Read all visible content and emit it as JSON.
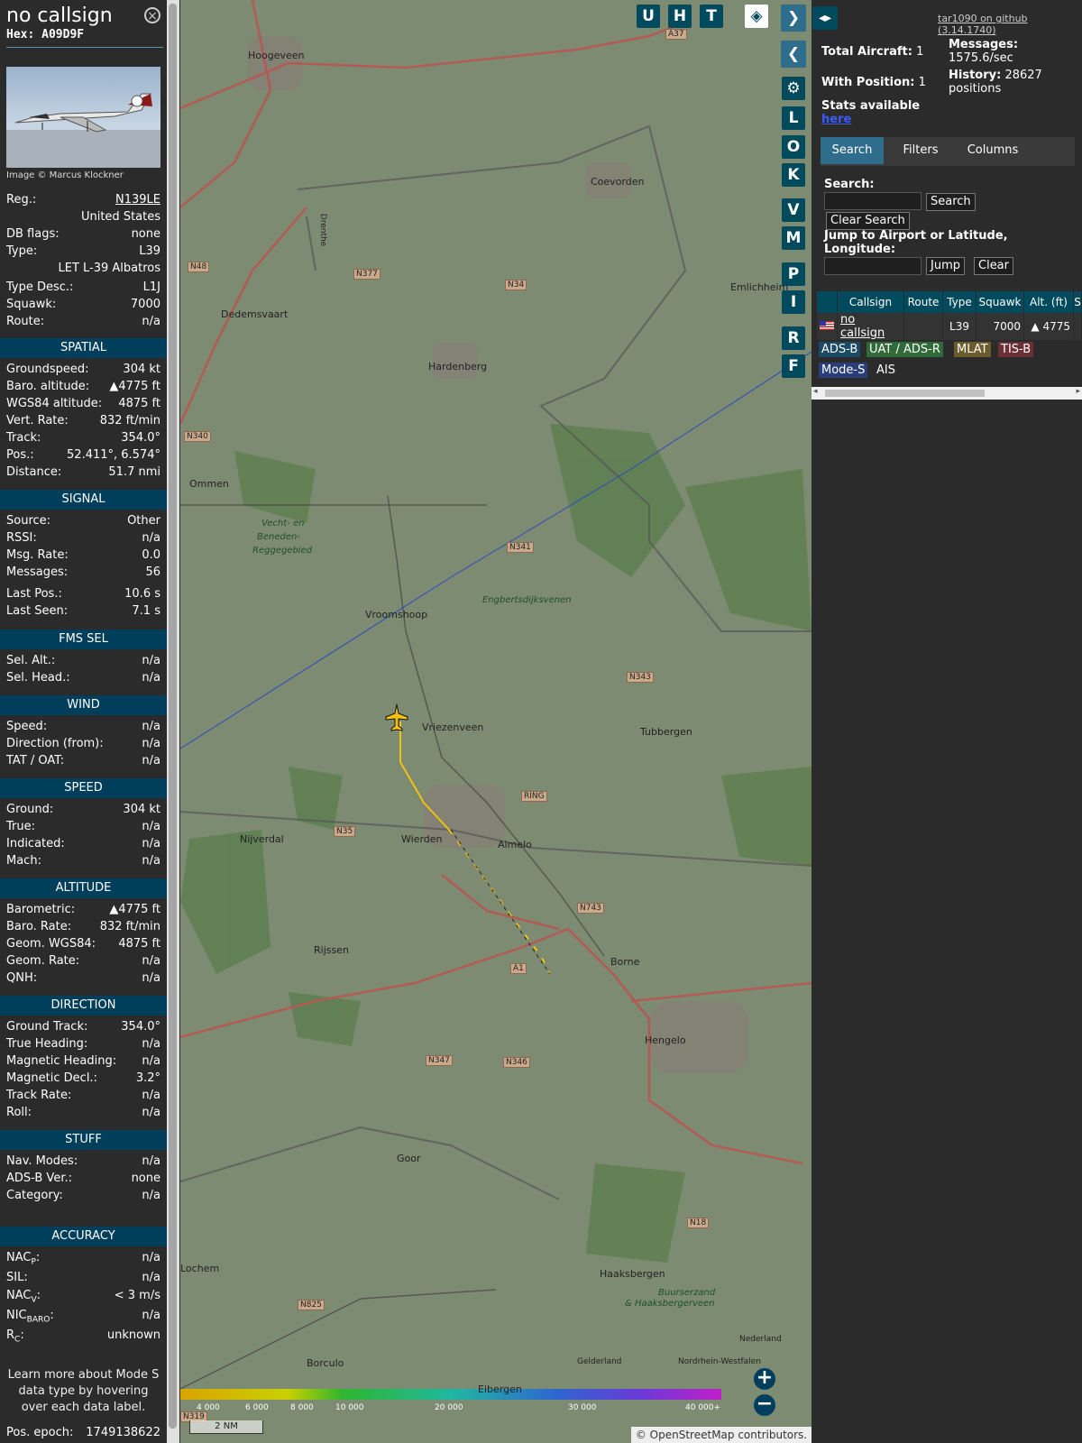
{
  "info": {
    "callsign": "no callsign",
    "hex_label": "Hex:",
    "hex": "A09D9F",
    "close_icon": "×",
    "photo_credit": "Image © Marcus Klockner",
    "rows_top": [
      {
        "label": "Reg.:",
        "value": "N139LE"
      },
      {
        "label": "",
        "value": "United States"
      },
      {
        "label": "DB flags:",
        "value": "none"
      },
      {
        "label": "Type:",
        "value": "L39"
      },
      {
        "label": "",
        "value": "LET L-39 Albatros"
      },
      {
        "label": "Type Desc.:",
        "value": "L1J"
      },
      {
        "label": "Squawk:",
        "value": "7000"
      },
      {
        "label": "Route:",
        "value": "n/a"
      }
    ],
    "sections": {
      "spatial": "SPATIAL",
      "signal": "SIGNAL",
      "fms": "FMS SEL",
      "wind": "WIND",
      "speed": "SPEED",
      "altitude": "ALTITUDE",
      "direction": "DIRECTION",
      "stuff": "STUFF",
      "accuracy": "ACCURACY"
    },
    "spatial": [
      {
        "label": "Groundspeed:",
        "value": "304 kt"
      },
      {
        "label": "Baro. altitude:",
        "value": "▲4775 ft"
      },
      {
        "label": "WGS84 altitude:",
        "value": "4875 ft"
      },
      {
        "label": "Vert. Rate:",
        "value": "832 ft/min"
      },
      {
        "label": "Track:",
        "value": "354.0°"
      },
      {
        "label": "Pos.:",
        "value": "52.411°, 6.574°"
      },
      {
        "label": "Distance:",
        "value": "51.7 nmi"
      }
    ],
    "signal": [
      {
        "label": "Source:",
        "value": "Other"
      },
      {
        "label": "RSSI:",
        "value": "n/a"
      },
      {
        "label": "Msg. Rate:",
        "value": "0.0"
      },
      {
        "label": "Messages:",
        "value": "56"
      },
      {
        "label": "Last Pos.:",
        "value": "10.6 s"
      },
      {
        "label": "Last Seen:",
        "value": "7.1 s"
      }
    ],
    "fms": [
      {
        "label": "Sel. Alt.:",
        "value": "n/a"
      },
      {
        "label": "Sel. Head.:",
        "value": "n/a"
      }
    ],
    "wind": [
      {
        "label": "Speed:",
        "value": "n/a"
      },
      {
        "label": "Direction (from):",
        "value": "n/a"
      },
      {
        "label": "TAT / OAT:",
        "value": "n/a"
      }
    ],
    "speed": [
      {
        "label": "Ground:",
        "value": "304 kt"
      },
      {
        "label": "True:",
        "value": "n/a"
      },
      {
        "label": "Indicated:",
        "value": "n/a"
      },
      {
        "label": "Mach:",
        "value": "n/a"
      }
    ],
    "altitude": [
      {
        "label": "Barometric:",
        "value": "▲4775 ft"
      },
      {
        "label": "Baro. Rate:",
        "value": "832 ft/min"
      },
      {
        "label": "Geom. WGS84:",
        "value": "4875 ft"
      },
      {
        "label": "Geom. Rate:",
        "value": "n/a"
      },
      {
        "label": "QNH:",
        "value": "n/a"
      }
    ],
    "direction": [
      {
        "label": "Ground Track:",
        "value": "354.0°"
      },
      {
        "label": "True Heading:",
        "value": "n/a"
      },
      {
        "label": "Magnetic Heading:",
        "value": "n/a"
      },
      {
        "label": "Magnetic Decl.:",
        "value": "3.2°"
      },
      {
        "label": "Track Rate:",
        "value": "n/a"
      },
      {
        "label": "Roll:",
        "value": "n/a"
      }
    ],
    "stuff": [
      {
        "label": "Nav. Modes:",
        "value": "n/a"
      },
      {
        "label": "ADS-B Ver.:",
        "value": "none"
      },
      {
        "label": "Category:",
        "value": "n/a"
      }
    ],
    "accuracy": {
      "nacp_label": "NAC",
      "nacp_sub": "P",
      "nacp_value": "n/a",
      "sil_label": "SIL:",
      "sil_value": "n/a",
      "nacv_label": "NAC",
      "nacv_sub": "V",
      "nacv_value": "< 3 m/s",
      "nicbaro_label": "NIC",
      "nicbaro_sub": "BARO",
      "nicbaro_value": "n/a",
      "rc_label": "R",
      "rc_sub": "C",
      "rc_value": "unknown"
    },
    "footer_note": "Learn more about Mode S data type by hovering over each data label.",
    "pos_epoch_label": "Pos. epoch:",
    "pos_epoch_value": "1749138622"
  },
  "map": {
    "buttons_top": [
      "U",
      "H",
      "T"
    ],
    "buttons_side": [
      "L",
      "O",
      "K",
      "V",
      "M",
      "P",
      "I",
      "R",
      "F"
    ],
    "places": [
      {
        "name": "Hoogeveen"
      },
      {
        "name": "Coevorden"
      },
      {
        "name": "Dedemsvaart"
      },
      {
        "name": "Hardenberg"
      },
      {
        "name": "Emlichheim"
      },
      {
        "name": "Ommen"
      },
      {
        "name": "Vecht- en"
      },
      {
        "name": "Beneden-"
      },
      {
        "name": "Reggegebied"
      },
      {
        "name": "Vroomshoop"
      },
      {
        "name": "Engbertsdijksvenen"
      },
      {
        "name": "Vriezenveen"
      },
      {
        "name": "Tubbergen"
      },
      {
        "name": "Nijverdal"
      },
      {
        "name": "Wierden"
      },
      {
        "name": "Almelo"
      },
      {
        "name": "Rijssen"
      },
      {
        "name": "Borne"
      },
      {
        "name": "Hengelo"
      },
      {
        "name": "Goor"
      },
      {
        "name": "Lochem"
      },
      {
        "name": "Haaksbergen"
      },
      {
        "name": "Buurserzand"
      },
      {
        "name": "& Haaksbergerveen"
      },
      {
        "name": "Borculo"
      },
      {
        "name": "Eibergen"
      },
      {
        "name": "Drenthe"
      },
      {
        "name": "Gelderland"
      },
      {
        "name": "Nordrhein-Westfalen"
      },
      {
        "name": "Nederland"
      }
    ],
    "roads": [
      "A37",
      "N48",
      "N377",
      "N34",
      "N340",
      "N341",
      "N343",
      "RING",
      "N35",
      "N743",
      "A1",
      "N347",
      "N346",
      "N18",
      "N825",
      "N319"
    ],
    "scale_ticks": [
      "4 000",
      "6 000",
      "8 000",
      "10 000",
      "20 000",
      "30 000",
      "40 000+"
    ],
    "scale_label": "2 NM",
    "zoom_in": "+",
    "zoom_out": "−",
    "attribution": "© OpenStreetMap contributors."
  },
  "right": {
    "github_link": "tar1090 on github (3.14.1740)",
    "total_aircraft_label": "Total Aircraft:",
    "total_aircraft": "1",
    "with_position_label": "With Position:",
    "with_position": "1",
    "messages_label": "Messages:",
    "messages_value": "1575.6/sec",
    "history_label": "History:",
    "history_value": "28627",
    "history_unit": "positions",
    "stats_label": "Stats available",
    "stats_link": "here",
    "tabs": [
      "Search",
      "Filters",
      "Columns"
    ],
    "search_label": "Search:",
    "search_button": "Search",
    "clear_search_button": "Clear Search",
    "jump_label": "Jump to Airport or Latitude, Longitude:",
    "jump_button": "Jump",
    "clear_button": "Clear",
    "table": {
      "headers": [
        "",
        "Callsign",
        "Route",
        "Type",
        "Squawk",
        "Alt. (ft)",
        "S"
      ],
      "row": {
        "callsign": "no callsign",
        "route": "",
        "type": "L39",
        "squawk": "7000",
        "alt": "▲ 4775"
      }
    },
    "sources": [
      "ADS-B",
      "UAT / ADS-R",
      "MLAT",
      "TIS-B",
      "Mode-S",
      "AIS"
    ]
  },
  "colors": {
    "section_bg": "#003f5c",
    "accent": "#2f6d8c",
    "track": "#f2c10f"
  }
}
